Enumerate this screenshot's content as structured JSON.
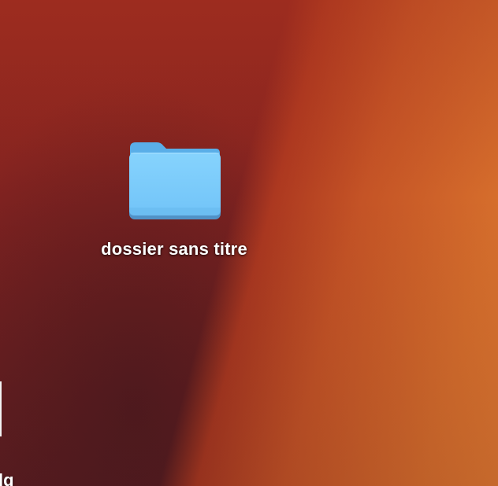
{
  "desktop": {
    "items": [
      {
        "label": "dossier sans titre",
        "icon": "folder-icon"
      }
    ],
    "edge_item": {
      "label": "lg",
      "icon": "partial-file-icon"
    }
  },
  "colors": {
    "folder_body": "#7ccdfb",
    "folder_tab": "#5aaee8",
    "wallpaper_dark": "#5f1e22",
    "wallpaper_orange": "#de7830"
  }
}
